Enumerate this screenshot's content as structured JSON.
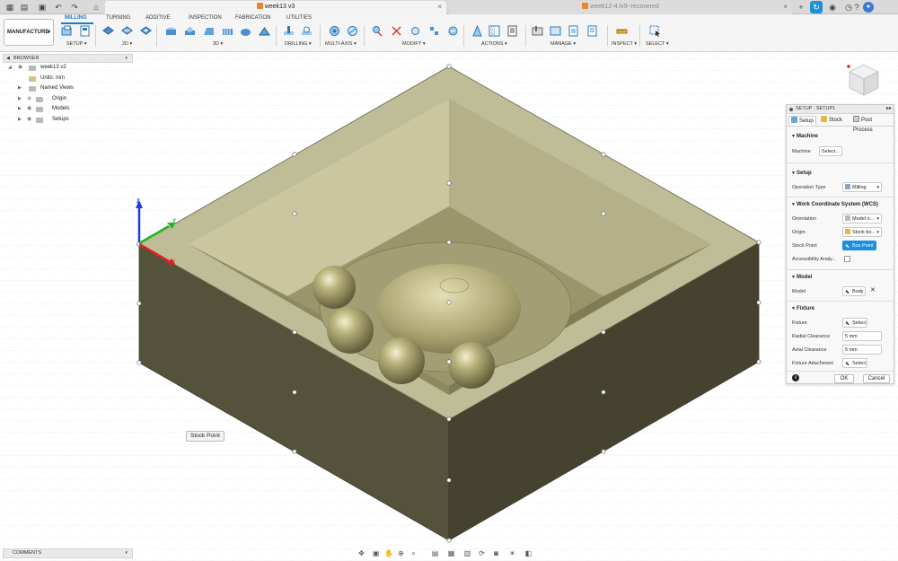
{
  "tabbar": {
    "active_tab": "week13 v3",
    "inactive_tab": "week12-4.lv9~recovered",
    "close_glyph": "×",
    "add_glyph": "+",
    "account_glyph": "↻"
  },
  "ribbon": {
    "workspace": "MANUFACTURE",
    "tabs": [
      "MILLING",
      "TURNING",
      "ADDITIVE",
      "INSPECTION",
      "FABRICATION",
      "UTILITIES"
    ],
    "groups": [
      "SETUP ▾",
      "2D ▾",
      "3D ▾",
      "DRILLING ▾",
      "MULTI-AXIS ▾",
      "MODIFY ▾",
      "ACTIONS ▾",
      "MANAGE ▾",
      "INSPECT ▾",
      "SELECT ▾"
    ],
    "accent_color": "#1b7dc7"
  },
  "browser": {
    "title": "BROWSER",
    "items": [
      {
        "label": "week13 v2",
        "icon": "document-icon"
      },
      {
        "label": "Units: mm",
        "icon": "units-icon"
      },
      {
        "label": "Named Views",
        "icon": "folder-icon"
      },
      {
        "label": "Origin",
        "icon": "folder-icon"
      },
      {
        "label": "Models",
        "icon": "folder-icon"
      },
      {
        "label": "Setups",
        "icon": "folder-icon"
      }
    ]
  },
  "viewport": {
    "tooltip": "Stock Point",
    "axis_z_label": "Z",
    "axis_y_label": "Y",
    "axis_x_label": "X"
  },
  "comments": {
    "title": "COMMENTS"
  },
  "setup": {
    "title": "SETUP : SETUP1",
    "tabs": [
      "Setup",
      "Stock",
      "Post Process"
    ],
    "sections": {
      "machine": "Machine",
      "setup": "Setup",
      "wcs": "Work Coordinate System (WCS)",
      "model": "Model",
      "fixture": "Fixture"
    },
    "fields": {
      "machine_label": "Machine",
      "machine_value": "Select...",
      "operation_type_label": "Operation Type",
      "operation_type_value": "Milling",
      "orientation_label": "Orientation",
      "orientation_value": "Model o...",
      "origin_label": "Origin",
      "origin_value": "Stock bo...",
      "stock_point_label": "Stock Point",
      "stock_point_value": "Box Point",
      "accessibility_label": "Accessibility Analy...",
      "model_label": "Model",
      "model_value": "Body",
      "fixture_label": "Fixture",
      "fixture_value": "Select",
      "radial_clearance_label": "Radial Clearance",
      "radial_clearance_value": "5 mm",
      "axial_clearance_label": "Axial Clearance",
      "axial_clearance_value": "5 mm",
      "fixture_attachment_label": "Fixture Attachment",
      "fixture_attachment_value": "Select"
    },
    "ok": "OK",
    "cancel": "Cancel",
    "info": "i"
  }
}
